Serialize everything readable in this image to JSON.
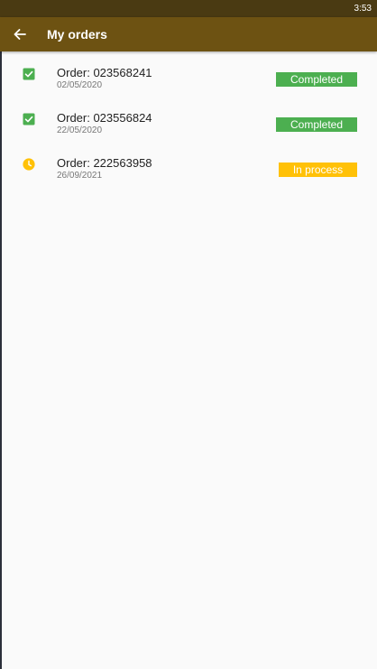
{
  "status_bar": {
    "time": "3:53"
  },
  "app_bar": {
    "title": "My orders",
    "back_icon": "arrow-left-icon"
  },
  "colors": {
    "app_bar": "#6d5212",
    "status_bar": "#4a3a12",
    "completed": "#4caf50",
    "in_process": "#ffc107"
  },
  "orders": [
    {
      "title": "Order: 023568241",
      "date": "02/05/2020",
      "status": "Completed",
      "icon": "check-box-icon"
    },
    {
      "title": "Order: 023556824",
      "date": "22/05/2020",
      "status": "Completed",
      "icon": "check-box-icon"
    },
    {
      "title": "Order: 222563958",
      "date": "26/09/2021",
      "status": "In process",
      "icon": "clock-icon"
    }
  ]
}
